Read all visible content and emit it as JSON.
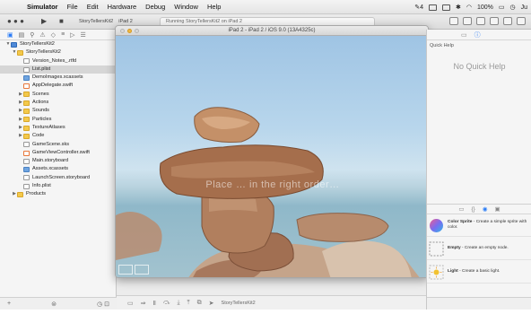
{
  "menubar": {
    "apple_glyph": "",
    "items": [
      "Simulator",
      "File",
      "Edit",
      "Hardware",
      "Debug",
      "Window",
      "Help"
    ],
    "status": {
      "badge": "4",
      "battery": "100%",
      "user": "Ju"
    }
  },
  "toolbar": {
    "scheme_target": "StoryTellersKit2",
    "scheme_device": "iPad 2",
    "activity_text": "Running StoryTellersKit2 on iPad 2"
  },
  "navigator": {
    "items": [
      {
        "label": "StoryTellersKit2",
        "depth": 0,
        "icon": "project",
        "disclosure": "open"
      },
      {
        "label": "StoryTellersKit2",
        "depth": 1,
        "icon": "folder",
        "disclosure": "open"
      },
      {
        "label": "Version_Notes_.rtfd",
        "depth": 2,
        "icon": "file",
        "disclosure": ""
      },
      {
        "label": "List.plist",
        "depth": 2,
        "icon": "file",
        "disclosure": "",
        "selected": true
      },
      {
        "label": "DemoImages.xcassets",
        "depth": 2,
        "icon": "blue",
        "disclosure": ""
      },
      {
        "label": "AppDelegate.swift",
        "depth": 2,
        "icon": "swift",
        "disclosure": ""
      },
      {
        "label": "Scenes",
        "depth": 2,
        "icon": "folder",
        "disclosure": "closed"
      },
      {
        "label": "Actions",
        "depth": 2,
        "icon": "folder",
        "disclosure": "closed"
      },
      {
        "label": "Sounds",
        "depth": 2,
        "icon": "folder",
        "disclosure": "closed"
      },
      {
        "label": "Particles",
        "depth": 2,
        "icon": "folder",
        "disclosure": "closed"
      },
      {
        "label": "TextureAtlases",
        "depth": 2,
        "icon": "folder",
        "disclosure": "closed"
      },
      {
        "label": "Code",
        "depth": 2,
        "icon": "folder",
        "disclosure": "closed"
      },
      {
        "label": "GameScene.sks",
        "depth": 2,
        "icon": "file",
        "disclosure": ""
      },
      {
        "label": "GameViewController.swift",
        "depth": 2,
        "icon": "swift",
        "disclosure": ""
      },
      {
        "label": "Main.storyboard",
        "depth": 2,
        "icon": "file",
        "disclosure": ""
      },
      {
        "label": "Assets.xcassets",
        "depth": 2,
        "icon": "blue",
        "disclosure": ""
      },
      {
        "label": "LaunchScreen.storyboard",
        "depth": 2,
        "icon": "file",
        "disclosure": ""
      },
      {
        "label": "Info.plist",
        "depth": 2,
        "icon": "file",
        "disclosure": ""
      },
      {
        "label": "Products",
        "depth": 1,
        "icon": "folder",
        "disclosure": "closed"
      }
    ]
  },
  "simulator": {
    "window_title": "iPad 2 - iPad 2 / iOS 9.0 (13A4325c)",
    "overlay_text": "Place … in the right order…"
  },
  "editor_bottom": {
    "label": "StoryTellersKit2"
  },
  "utilities": {
    "quick_help_title": "Quick Help",
    "no_quick_help": "No Quick Help",
    "library": [
      {
        "name": "Color Sprite",
        "desc": " - Create a simple sprite with color."
      },
      {
        "name": "Empty",
        "desc": " - Create an empty node."
      },
      {
        "name": "Light",
        "desc": " - Create a basic light."
      }
    ]
  },
  "colors": {
    "accent": "#2a7cf6",
    "selection": "#d6d6d6",
    "folder": "#f3c94b"
  }
}
